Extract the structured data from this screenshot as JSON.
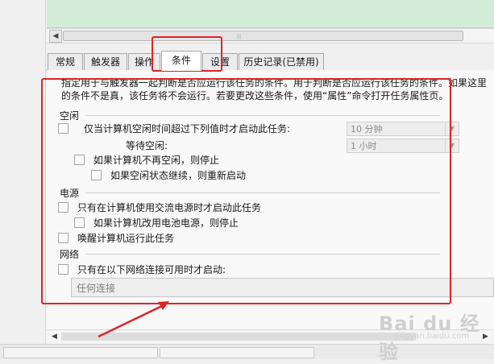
{
  "tabs": [
    {
      "label": "常规",
      "active": false
    },
    {
      "label": "触发器",
      "active": false
    },
    {
      "label": "操作",
      "active": false
    },
    {
      "label": "条件",
      "active": true
    },
    {
      "label": "设置",
      "active": false
    },
    {
      "label": "历史记录(已禁用)",
      "active": false
    }
  ],
  "description": "指定用于与触发器一起判断是否应运行该任务的条件。用于判断是否应运行该任务的条件。如果这里的条件不是真，该任务将不会运行。若要更改这些条件，使用“属性”命令打开任务属性页。",
  "idle": {
    "section_label": "空闲",
    "start_only_idle_label": "仅当计算机空闲时间超过下列值时才启动此任务:",
    "idle_duration_value": "10 分钟",
    "wait_for_idle_label": "等待空闲:",
    "wait_for_idle_value": "1 小时",
    "stop_if_not_idle_label": "如果计算机不再空闲，则停止",
    "restart_if_idle_resumes_label": "如果空闲状态继续，则重新启动"
  },
  "power": {
    "section_label": "电源",
    "ac_power_label": "只有在计算机使用交流电源时才启动此任务",
    "stop_on_battery_label": "如果计算机改用电池电源，则停止",
    "wake_to_run_label": "唤醒计算机运行此任务"
  },
  "network": {
    "section_label": "网络",
    "network_only_label": "只有在以下网络连接可用时才启动:",
    "network_value": "任何连接"
  },
  "colors": {
    "annotation_red": "#e02424",
    "top_panel_green": "#d3ecd7"
  },
  "watermark": {
    "brand": "Bai du 经验",
    "url": "jingyan.baidu.com"
  }
}
